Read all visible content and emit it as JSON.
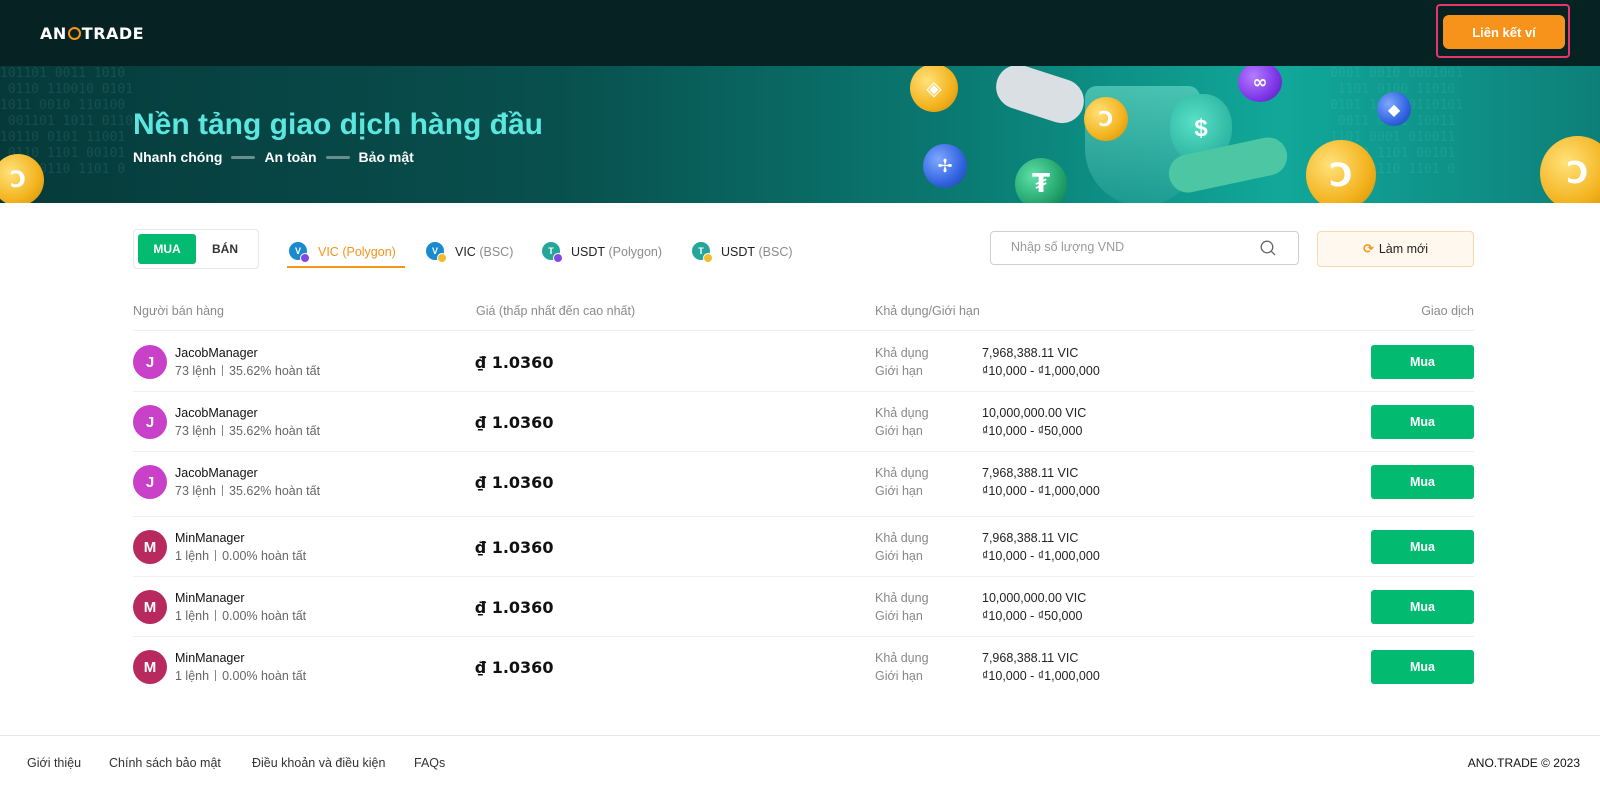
{
  "header": {
    "logo_left": "AN",
    "logo_right": "TRADE",
    "connect_wallet_label": "Liên kết ví",
    "accent_color": "#f7931a",
    "bg_color": "#062222"
  },
  "banner": {
    "title": "Nền tảng giao dịch hàng đầu",
    "tags": [
      "Nhanh chóng",
      "An toàn",
      "Bảo mật"
    ]
  },
  "filters": {
    "buy_label": "MUA",
    "sell_label": "BÁN",
    "tabs": [
      {
        "coin": "VIC",
        "network": "(Polygon)",
        "icon": "vic-polygon-icon",
        "active": true
      },
      {
        "coin": "VIC",
        "network": "(BSC)",
        "icon": "vic-bsc-icon",
        "active": false
      },
      {
        "coin": "USDT",
        "network": "(Polygon)",
        "icon": "usdt-polygon-icon",
        "active": false
      },
      {
        "coin": "USDT",
        "network": "(BSC)",
        "icon": "usdt-bsc-icon",
        "active": false
      }
    ],
    "search_placeholder": "Nhập số lượng VND",
    "refresh_label": "Làm mới"
  },
  "table": {
    "headers": [
      "Người bán hàng",
      "Giá (thấp nhất đến cao nhất)",
      "Khả dụng/Giới hạn",
      "Giao dịch"
    ],
    "available_label": "Khả dụng",
    "limit_label": "Giới hạn",
    "buy_button_label": "Mua",
    "rows": [
      {
        "initial": "J",
        "name": "JacobManager",
        "orders": "73 lệnh",
        "completion": "35.62% hoàn tất",
        "price": "₫ 1.0360",
        "available": "7,968,388.11 VIC",
        "limit": "₫10,000 - ₫1,000,000"
      },
      {
        "initial": "J",
        "name": "JacobManager",
        "orders": "73 lệnh",
        "completion": "35.62% hoàn tất",
        "price": "₫ 1.0360",
        "available": "10,000,000.00 VIC",
        "limit": "₫10,000 - ₫50,000"
      },
      {
        "initial": "J",
        "name": "JacobManager",
        "orders": "73 lệnh",
        "completion": "35.62% hoàn tất",
        "price": "₫ 1.0360",
        "available": "7,968,388.11 VIC",
        "limit": "₫10,000 - ₫1,000,000"
      },
      {
        "initial": "M",
        "name": "MinManager",
        "orders": "1 lệnh",
        "completion": "0.00% hoàn tất",
        "price": "₫ 1.0360",
        "available": "7,968,388.11 VIC",
        "limit": "₫10,000 - ₫1,000,000"
      },
      {
        "initial": "M",
        "name": "MinManager",
        "orders": "1 lệnh",
        "completion": "0.00% hoàn tất",
        "price": "₫ 1.0360",
        "available": "10,000,000.00 VIC",
        "limit": "₫10,000 - ₫50,000"
      },
      {
        "initial": "M",
        "name": "MinManager",
        "orders": "1 lệnh",
        "completion": "0.00% hoàn tất",
        "price": "₫ 1.0360",
        "available": "7,968,388.11 VIC",
        "limit": "₫10,000 - ₫1,000,000"
      }
    ]
  },
  "footer": {
    "links": [
      "Giới thiệu",
      "Chính sách bảo mật",
      "Điều khoản và điều kiện",
      "FAQs"
    ],
    "copyright": "ANO.TRADE © 2023"
  },
  "colors": {
    "buy_green": "#02bb70",
    "banner_title": "#5be6df",
    "highlight_border": "#e8356d"
  }
}
